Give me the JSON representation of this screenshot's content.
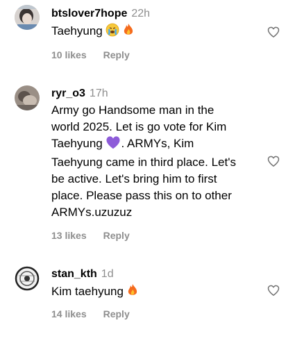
{
  "comments": [
    {
      "username": "btslover7hope",
      "time": "22h",
      "text": "Taehyung",
      "emojis": [
        "crying-face-emoji",
        "fire-emoji"
      ],
      "likes": "10 likes",
      "reply": "Reply"
    },
    {
      "username": "ryr_o3",
      "time": "17h",
      "text_lines": [
        "Army go Handsome man in the",
        "world 2025. Let is go vote for Kim",
        "Taehyung",
        ". ARMYs, Kim",
        "Taehyung came in third place. Let's",
        "be active. Let's bring him to first",
        "place. Please pass this on to other",
        "ARMYs.uzuzuz"
      ],
      "emojis": [
        "purple-heart-emoji"
      ],
      "likes": "13 likes",
      "reply": "Reply"
    },
    {
      "username": "stan_kth",
      "time": "1d",
      "text": "Kim taehyung",
      "emojis": [
        "fire-emoji"
      ],
      "likes": "14 likes",
      "reply": "Reply"
    }
  ],
  "colors": {
    "meta_gray": "#8e8e8e",
    "purple_heart": "#8e5cd9",
    "fire": "#f56b1d"
  }
}
